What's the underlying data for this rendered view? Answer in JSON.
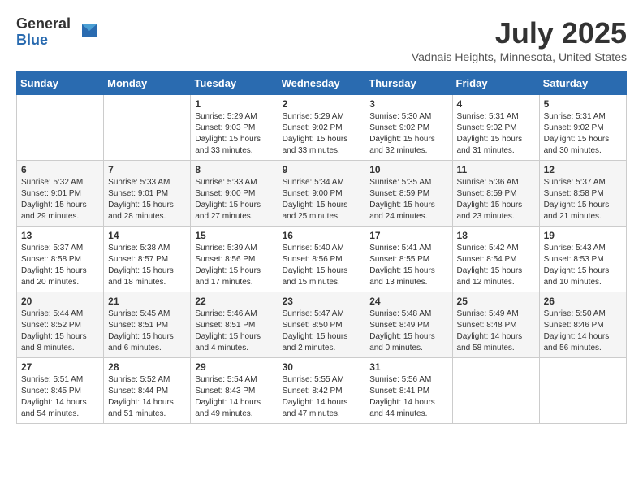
{
  "logo": {
    "general": "General",
    "blue": "Blue"
  },
  "title": "July 2025",
  "location": "Vadnais Heights, Minnesota, United States",
  "days_of_week": [
    "Sunday",
    "Monday",
    "Tuesday",
    "Wednesday",
    "Thursday",
    "Friday",
    "Saturday"
  ],
  "weeks": [
    [
      {
        "day": "",
        "info": ""
      },
      {
        "day": "",
        "info": ""
      },
      {
        "day": "1",
        "info": "Sunrise: 5:29 AM\nSunset: 9:03 PM\nDaylight: 15 hours and 33 minutes."
      },
      {
        "day": "2",
        "info": "Sunrise: 5:29 AM\nSunset: 9:02 PM\nDaylight: 15 hours and 33 minutes."
      },
      {
        "day": "3",
        "info": "Sunrise: 5:30 AM\nSunset: 9:02 PM\nDaylight: 15 hours and 32 minutes."
      },
      {
        "day": "4",
        "info": "Sunrise: 5:31 AM\nSunset: 9:02 PM\nDaylight: 15 hours and 31 minutes."
      },
      {
        "day": "5",
        "info": "Sunrise: 5:31 AM\nSunset: 9:02 PM\nDaylight: 15 hours and 30 minutes."
      }
    ],
    [
      {
        "day": "6",
        "info": "Sunrise: 5:32 AM\nSunset: 9:01 PM\nDaylight: 15 hours and 29 minutes."
      },
      {
        "day": "7",
        "info": "Sunrise: 5:33 AM\nSunset: 9:01 PM\nDaylight: 15 hours and 28 minutes."
      },
      {
        "day": "8",
        "info": "Sunrise: 5:33 AM\nSunset: 9:00 PM\nDaylight: 15 hours and 27 minutes."
      },
      {
        "day": "9",
        "info": "Sunrise: 5:34 AM\nSunset: 9:00 PM\nDaylight: 15 hours and 25 minutes."
      },
      {
        "day": "10",
        "info": "Sunrise: 5:35 AM\nSunset: 8:59 PM\nDaylight: 15 hours and 24 minutes."
      },
      {
        "day": "11",
        "info": "Sunrise: 5:36 AM\nSunset: 8:59 PM\nDaylight: 15 hours and 23 minutes."
      },
      {
        "day": "12",
        "info": "Sunrise: 5:37 AM\nSunset: 8:58 PM\nDaylight: 15 hours and 21 minutes."
      }
    ],
    [
      {
        "day": "13",
        "info": "Sunrise: 5:37 AM\nSunset: 8:58 PM\nDaylight: 15 hours and 20 minutes."
      },
      {
        "day": "14",
        "info": "Sunrise: 5:38 AM\nSunset: 8:57 PM\nDaylight: 15 hours and 18 minutes."
      },
      {
        "day": "15",
        "info": "Sunrise: 5:39 AM\nSunset: 8:56 PM\nDaylight: 15 hours and 17 minutes."
      },
      {
        "day": "16",
        "info": "Sunrise: 5:40 AM\nSunset: 8:56 PM\nDaylight: 15 hours and 15 minutes."
      },
      {
        "day": "17",
        "info": "Sunrise: 5:41 AM\nSunset: 8:55 PM\nDaylight: 15 hours and 13 minutes."
      },
      {
        "day": "18",
        "info": "Sunrise: 5:42 AM\nSunset: 8:54 PM\nDaylight: 15 hours and 12 minutes."
      },
      {
        "day": "19",
        "info": "Sunrise: 5:43 AM\nSunset: 8:53 PM\nDaylight: 15 hours and 10 minutes."
      }
    ],
    [
      {
        "day": "20",
        "info": "Sunrise: 5:44 AM\nSunset: 8:52 PM\nDaylight: 15 hours and 8 minutes."
      },
      {
        "day": "21",
        "info": "Sunrise: 5:45 AM\nSunset: 8:51 PM\nDaylight: 15 hours and 6 minutes."
      },
      {
        "day": "22",
        "info": "Sunrise: 5:46 AM\nSunset: 8:51 PM\nDaylight: 15 hours and 4 minutes."
      },
      {
        "day": "23",
        "info": "Sunrise: 5:47 AM\nSunset: 8:50 PM\nDaylight: 15 hours and 2 minutes."
      },
      {
        "day": "24",
        "info": "Sunrise: 5:48 AM\nSunset: 8:49 PM\nDaylight: 15 hours and 0 minutes."
      },
      {
        "day": "25",
        "info": "Sunrise: 5:49 AM\nSunset: 8:48 PM\nDaylight: 14 hours and 58 minutes."
      },
      {
        "day": "26",
        "info": "Sunrise: 5:50 AM\nSunset: 8:46 PM\nDaylight: 14 hours and 56 minutes."
      }
    ],
    [
      {
        "day": "27",
        "info": "Sunrise: 5:51 AM\nSunset: 8:45 PM\nDaylight: 14 hours and 54 minutes."
      },
      {
        "day": "28",
        "info": "Sunrise: 5:52 AM\nSunset: 8:44 PM\nDaylight: 14 hours and 51 minutes."
      },
      {
        "day": "29",
        "info": "Sunrise: 5:54 AM\nSunset: 8:43 PM\nDaylight: 14 hours and 49 minutes."
      },
      {
        "day": "30",
        "info": "Sunrise: 5:55 AM\nSunset: 8:42 PM\nDaylight: 14 hours and 47 minutes."
      },
      {
        "day": "31",
        "info": "Sunrise: 5:56 AM\nSunset: 8:41 PM\nDaylight: 14 hours and 44 minutes."
      },
      {
        "day": "",
        "info": ""
      },
      {
        "day": "",
        "info": ""
      }
    ]
  ]
}
